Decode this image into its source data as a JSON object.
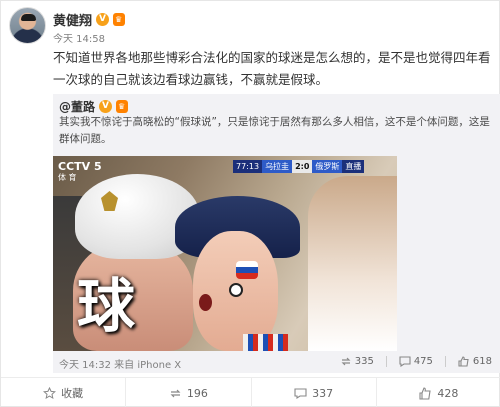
{
  "post": {
    "author": "黄健翔",
    "verified_mark": "V",
    "vip_mark": "♛",
    "time": "今天 14:58",
    "text": "不知道世界各地那些博彩合法化的国家的球迷是怎么想的，是不是也觉得四年看一次球的自己就该边看球边赢钱，不赢就是假球。"
  },
  "repost": {
    "author": "@董路",
    "verified_mark": "V",
    "vip_mark": "♛",
    "text": "其实我不惊诧于高晓松的“假球说”，只是惊诧于居然有那么多人相信，这不是个体问题，这是群体问题。",
    "image": {
      "tv_logo": "CCTV 5",
      "tv_sub": "体 育",
      "scoreboard": {
        "time": "77:13",
        "home": "乌拉圭",
        "score": "2:0",
        "away": "俄罗斯",
        "live": "直播"
      },
      "caption": "球"
    },
    "meta": "今天 14:32 来自 iPhone X",
    "reposts": "335",
    "comments": "475",
    "likes": "618"
  },
  "actions": {
    "favorite": "收藏",
    "repost": "196",
    "comment": "337",
    "like": "428"
  },
  "colors": {
    "accent": "#ff8200",
    "verified": "#f7a11a",
    "repost_bg": "#f2f2f5"
  }
}
